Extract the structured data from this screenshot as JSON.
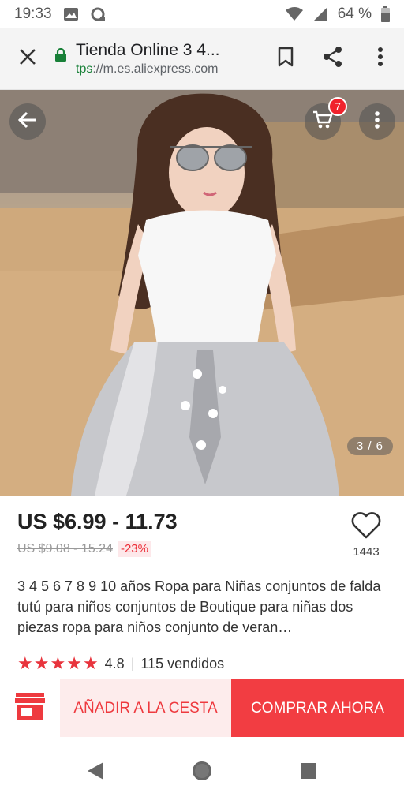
{
  "status_bar": {
    "time": "19:33",
    "battery": "64 %",
    "icons": [
      "image-icon",
      "sync-icon",
      "wifi-icon",
      "signal-icon",
      "battery-icon"
    ]
  },
  "browser": {
    "title": "Tienda Online 3 4...",
    "url_scheme": "tps",
    "url_rest": "://m.es.aliexpress.com",
    "icons": [
      "close-icon",
      "lock-icon",
      "bookmark-icon",
      "share-icon",
      "overflow-menu-icon"
    ]
  },
  "product_image": {
    "cart_count": "7",
    "counter": "3 / 6",
    "icons": [
      "back-arrow-icon",
      "cart-icon",
      "more-vert-icon"
    ]
  },
  "product": {
    "price": "US $6.99 - 11.73",
    "original_price": "US $9.08 - 15.24",
    "discount": "-23%",
    "wishlist_count": "1443",
    "description": "3 4 5 6 7 8 9 10 años Ropa para Niñas conjuntos de falda tutú para niños conjuntos de Boutique para niñas dos piezas ropa para niños conjunto de veran…",
    "rating": "4.8",
    "stars": 5,
    "sold": "115 vendidos"
  },
  "actions": {
    "add_to_cart": "AÑADIR A LA CESTA",
    "buy_now": "COMPRAR AHORA"
  },
  "colors": {
    "accent": "#f23d42",
    "accent_light": "#fdecec",
    "url_green": "#188038"
  }
}
